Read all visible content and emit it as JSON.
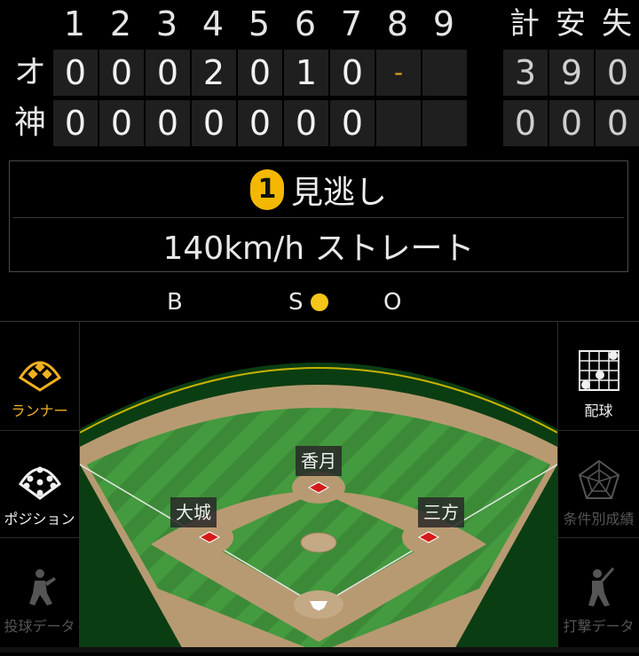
{
  "scoreboard": {
    "innings": [
      "1",
      "2",
      "3",
      "4",
      "5",
      "6",
      "7",
      "8",
      "9"
    ],
    "totals_headers": [
      "計",
      "安",
      "失"
    ],
    "teams": [
      {
        "name": "オ",
        "innings": [
          "0",
          "0",
          "0",
          "2",
          "0",
          "1",
          "0",
          "-",
          ""
        ],
        "totals": [
          "3",
          "9",
          "0"
        ]
      },
      {
        "name": "神",
        "innings": [
          "0",
          "0",
          "0",
          "0",
          "0",
          "0",
          "0",
          "",
          ""
        ],
        "totals": [
          "0",
          "0",
          "0"
        ]
      }
    ]
  },
  "play": {
    "pitch_number": "1",
    "result": "見逃し",
    "pitch_detail": "140km/h ストレート"
  },
  "count": {
    "balls_label": "B",
    "strikes_label": "S",
    "outs_label": "O",
    "balls": 0,
    "strikes": 1,
    "outs": 0
  },
  "left_menu": [
    {
      "label": "ランナー",
      "icon": "diamond-icon",
      "active": true
    },
    {
      "label": "ポジション",
      "icon": "position-icon",
      "active": false
    },
    {
      "label": "投球データ",
      "icon": "pitcher-icon",
      "active": false
    }
  ],
  "right_menu": [
    {
      "label": "配球",
      "icon": "pitch-grid-icon",
      "active": true
    },
    {
      "label": "条件別成績",
      "icon": "radar-chart-icon",
      "active": false
    },
    {
      "label": "打撃データ",
      "icon": "batter-icon",
      "active": false
    }
  ],
  "field": {
    "players": [
      {
        "name": "香月",
        "base": "second"
      },
      {
        "name": "大城",
        "base": "third"
      },
      {
        "name": "三方",
        "base": "first"
      }
    ]
  },
  "colors": {
    "accent": "#f5b800",
    "active_text": "#f0b020",
    "inactive_text": "#555555",
    "grass": "#3f8f3a",
    "dirt": "#b89a72"
  }
}
